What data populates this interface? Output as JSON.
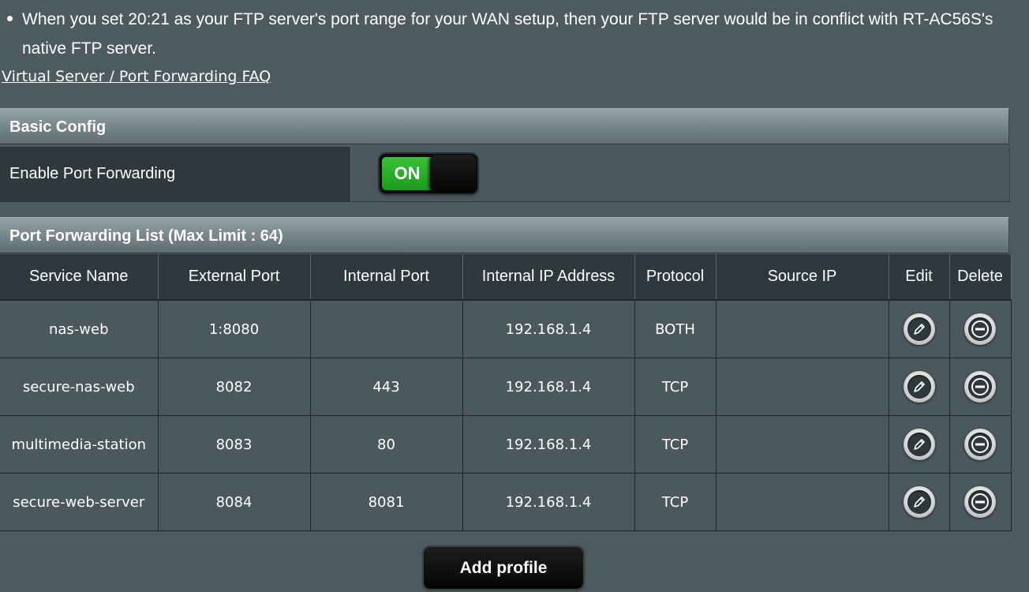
{
  "notes": {
    "ftp_note": "When you set 20:21 as your FTP server's port range for your WAN setup, then your FTP server would be in conflict with RT-AC56S's native FTP server.",
    "faq_link": "Virtual Server / Port Forwarding FAQ"
  },
  "basic_config": {
    "title": "Basic Config",
    "enable_label": "Enable Port Forwarding",
    "toggle_state": "ON"
  },
  "list": {
    "title": "Port Forwarding List (Max Limit : 64)",
    "columns": {
      "service_name": "Service Name",
      "external_port": "External Port",
      "internal_port": "Internal Port",
      "internal_ip": "Internal IP Address",
      "protocol": "Protocol",
      "source_ip": "Source IP",
      "edit": "Edit",
      "delete": "Delete"
    },
    "rows": [
      {
        "service_name": "nas-web",
        "external_port": "1:8080",
        "internal_port": "",
        "internal_ip": "192.168.1.4",
        "protocol": "BOTH",
        "source_ip": ""
      },
      {
        "service_name": "secure-nas-web",
        "external_port": "8082",
        "internal_port": "443",
        "internal_ip": "192.168.1.4",
        "protocol": "TCP",
        "source_ip": ""
      },
      {
        "service_name": "multimedia-station",
        "external_port": "8083",
        "internal_port": "80",
        "internal_ip": "192.168.1.4",
        "protocol": "TCP",
        "source_ip": ""
      },
      {
        "service_name": "secure-web-server",
        "external_port": "8084",
        "internal_port": "8081",
        "internal_ip": "192.168.1.4",
        "protocol": "TCP",
        "source_ip": ""
      }
    ]
  },
  "add_button": "Add profile",
  "icons": {
    "edit": "pencil-icon",
    "delete": "minus-circle-icon"
  },
  "colors": {
    "background": "#4d5a60",
    "toggle_on": "#2fb12f",
    "header_cell": "#2f393d"
  }
}
